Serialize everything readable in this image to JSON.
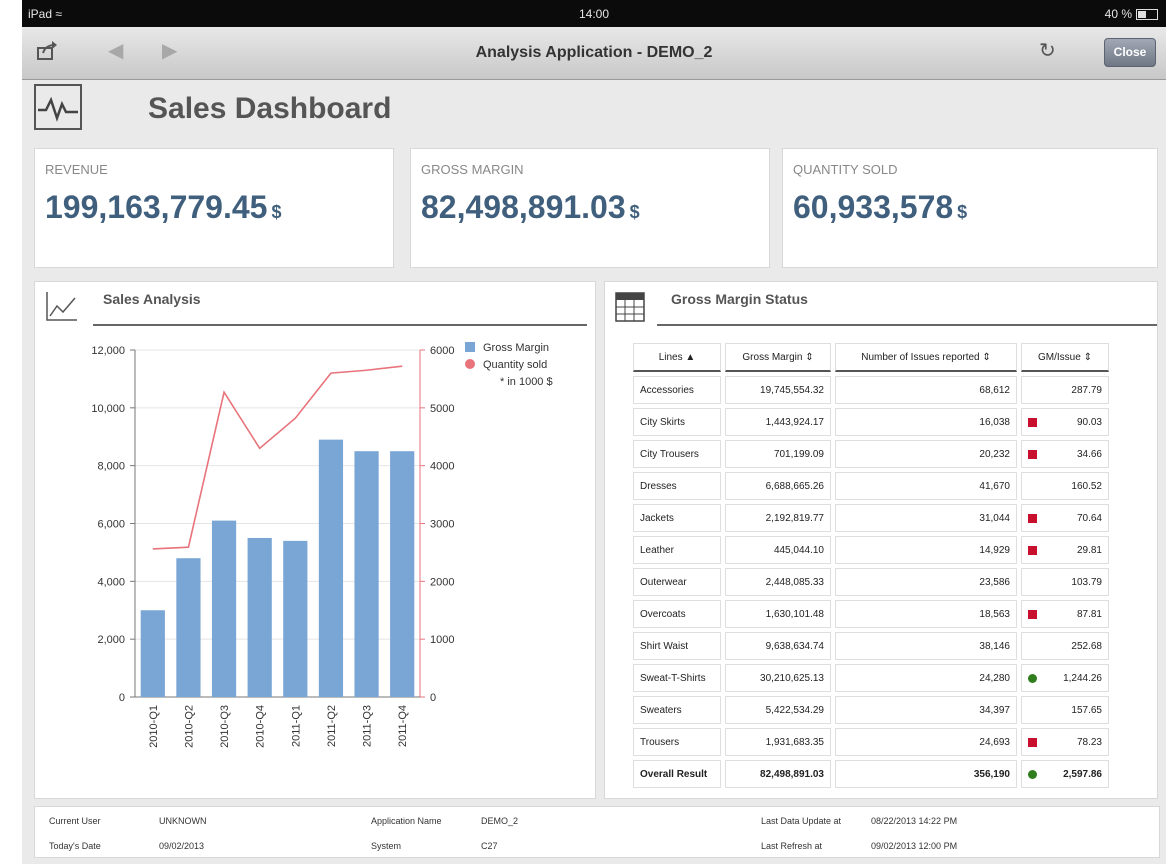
{
  "status_bar": {
    "device": "iPad",
    "time": "14:00",
    "battery": "40 %"
  },
  "nav": {
    "title": "Analysis Application - DEMO_2",
    "close_label": "Close"
  },
  "dashboard": {
    "title": "Sales Dashboard"
  },
  "kpis": [
    {
      "label": "REVENUE",
      "value": "199,163,779.45",
      "unit": "$"
    },
    {
      "label": "GROSS MARGIN",
      "value": "82,498,891.03",
      "unit": "$"
    },
    {
      "label": "QUANTITY SOLD",
      "value": "60,933,578",
      "unit": "$"
    }
  ],
  "sales_analysis": {
    "title": "Sales Analysis"
  },
  "chart_data": {
    "type": "bar",
    "categories": [
      "2010-Q1",
      "2010-Q2",
      "2010-Q3",
      "2010-Q4",
      "2011-Q1",
      "2011-Q2",
      "2011-Q3",
      "2011-Q4"
    ],
    "series": [
      {
        "name": "Gross Margin",
        "type": "bar",
        "axis": "left",
        "color": "#7aa6d6",
        "values": [
          3000,
          4800,
          6100,
          5500,
          5400,
          8900,
          8500,
          8500
        ]
      },
      {
        "name": "Quantity sold",
        "type": "line",
        "axis": "right",
        "color": "#e8737b",
        "values": [
          2560,
          2590,
          5270,
          4300,
          4820,
          5600,
          5650,
          5720
        ]
      }
    ],
    "y_left": {
      "min": 0,
      "max": 12000,
      "ticks": [
        "0",
        "2,000",
        "4,000",
        "6,000",
        "8,000",
        "10,000",
        "12,000"
      ]
    },
    "y_right": {
      "min": 0,
      "max": 6000,
      "ticks": [
        "0",
        "1000",
        "2000",
        "3000",
        "4000",
        "5000",
        "6000"
      ]
    },
    "note": "* in 1000 $",
    "legend_position": "top-right",
    "grid": true
  },
  "gross_margin_status": {
    "title": "Gross Margin Status",
    "columns": [
      "Lines",
      "Gross Margin",
      "Number of Issues reported",
      "GM/Issue"
    ],
    "rows": [
      {
        "line": "Accessories",
        "gm": "19,745,554.32",
        "issues": "68,612",
        "gmi": "287.79",
        "ind": ""
      },
      {
        "line": "City Skirts",
        "gm": "1,443,924.17",
        "issues": "16,038",
        "gmi": "90.03",
        "ind": "red"
      },
      {
        "line": "City Trousers",
        "gm": "701,199.09",
        "issues": "20,232",
        "gmi": "34.66",
        "ind": "red"
      },
      {
        "line": "Dresses",
        "gm": "6,688,665.26",
        "issues": "41,670",
        "gmi": "160.52",
        "ind": ""
      },
      {
        "line": "Jackets",
        "gm": "2,192,819.77",
        "issues": "31,044",
        "gmi": "70.64",
        "ind": "red"
      },
      {
        "line": "Leather",
        "gm": "445,044.10",
        "issues": "14,929",
        "gmi": "29.81",
        "ind": "red"
      },
      {
        "line": "Outerwear",
        "gm": "2,448,085.33",
        "issues": "23,586",
        "gmi": "103.79",
        "ind": ""
      },
      {
        "line": "Overcoats",
        "gm": "1,630,101.48",
        "issues": "18,563",
        "gmi": "87.81",
        "ind": "red"
      },
      {
        "line": "Shirt Waist",
        "gm": "9,638,634.74",
        "issues": "38,146",
        "gmi": "252.68",
        "ind": ""
      },
      {
        "line": "Sweat-T-Shirts",
        "gm": "30,210,625.13",
        "issues": "24,280",
        "gmi": "1,244.26",
        "ind": "green"
      },
      {
        "line": "Sweaters",
        "gm": "5,422,534.29",
        "issues": "34,397",
        "gmi": "157.65",
        "ind": ""
      },
      {
        "line": "Trousers",
        "gm": "1,931,683.35",
        "issues": "24,693",
        "gmi": "78.23",
        "ind": "red"
      },
      {
        "line": "Overall Result",
        "gm": "82,498,891.03",
        "issues": "356,190",
        "gmi": "2,597.86",
        "ind": "green",
        "total": true
      }
    ]
  },
  "footer": {
    "current_user_label": "Current User",
    "current_user": "UNKNOWN",
    "todays_date_label": "Today's Date",
    "todays_date": "09/02/2013",
    "app_name_label": "Application Name",
    "app_name": "DEMO_2",
    "system_label": "System",
    "system": "C27",
    "last_data_update_label": "Last Data Update at",
    "last_data_update": "08/22/2013 14:22 PM",
    "last_refresh_label": "Last Refresh at",
    "last_refresh": "09/02/2013 12:00 PM"
  }
}
